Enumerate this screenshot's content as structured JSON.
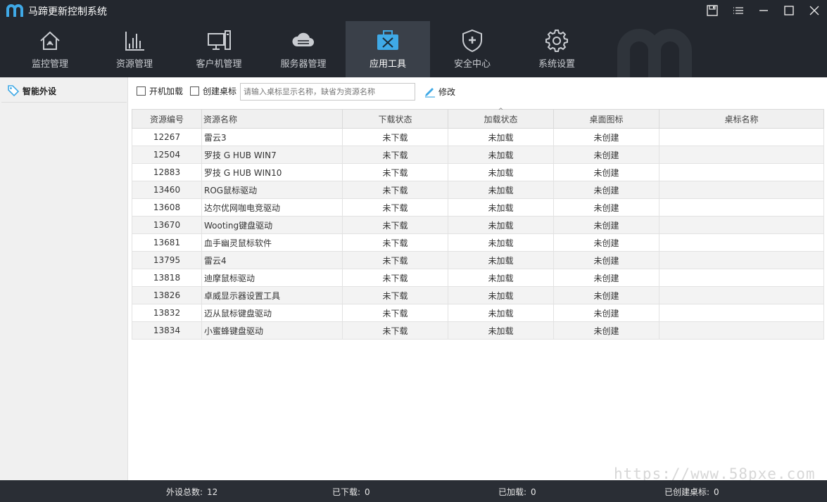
{
  "app": {
    "title": "马蹄更新控制系统"
  },
  "nav": [
    {
      "label": "监控管理",
      "icon": "home-monitor-icon"
    },
    {
      "label": "资源管理",
      "icon": "bar-chart-icon"
    },
    {
      "label": "客户机管理",
      "icon": "monitor-pc-icon"
    },
    {
      "label": "服务器管理",
      "icon": "cloud-server-icon"
    },
    {
      "label": "应用工具",
      "icon": "toolbox-icon",
      "active": true
    },
    {
      "label": "安全中心",
      "icon": "shield-icon"
    },
    {
      "label": "系统设置",
      "icon": "gear-icon"
    }
  ],
  "sidebar": {
    "items": [
      {
        "label": "智能外设",
        "icon": "tag-icon"
      }
    ]
  },
  "toolbar": {
    "autoload_label": "开机加载",
    "create_shortcut_label": "创建桌标",
    "name_placeholder": "请输入桌标显示名称，缺省为资源名称",
    "edit_label": "修改"
  },
  "table": {
    "columns": [
      "资源编号",
      "资源名称",
      "下载状态",
      "加载状态",
      "桌面图标",
      "桌标名称"
    ],
    "rows": [
      [
        "12267",
        "雷云3",
        "未下载",
        "未加载",
        "未创建",
        ""
      ],
      [
        "12504",
        "罗技 G HUB WIN7",
        "未下载",
        "未加载",
        "未创建",
        ""
      ],
      [
        "12883",
        "罗技 G HUB WIN10",
        "未下载",
        "未加载",
        "未创建",
        ""
      ],
      [
        "13460",
        "ROG鼠标驱动",
        "未下载",
        "未加载",
        "未创建",
        ""
      ],
      [
        "13608",
        "达尔优网咖电竞驱动",
        "未下载",
        "未加载",
        "未创建",
        ""
      ],
      [
        "13670",
        "Wooting键盘驱动",
        "未下载",
        "未加载",
        "未创建",
        ""
      ],
      [
        "13681",
        "血手幽灵鼠标软件",
        "未下载",
        "未加载",
        "未创建",
        ""
      ],
      [
        "13795",
        "雷云4",
        "未下载",
        "未加载",
        "未创建",
        ""
      ],
      [
        "13818",
        "迪摩鼠标驱动",
        "未下载",
        "未加载",
        "未创建",
        ""
      ],
      [
        "13826",
        "卓威显示器设置工具",
        "未下载",
        "未加载",
        "未创建",
        ""
      ],
      [
        "13832",
        "迈从鼠标键盘驱动",
        "未下载",
        "未加载",
        "未创建",
        ""
      ],
      [
        "13834",
        "小蜜蜂键盘驱动",
        "未下载",
        "未加载",
        "未创建",
        ""
      ]
    ]
  },
  "status": {
    "total_label": "外设总数:",
    "total_value": "12",
    "downloaded_label": "已下载:",
    "downloaded_value": "0",
    "loaded_label": "已加载:",
    "loaded_value": "0",
    "created_label": "已创建桌标:",
    "created_value": "0"
  },
  "watermark": "https://www.58pxe.com",
  "colors": {
    "header_bg": "#23272e",
    "active_tab": "#3a4049",
    "accent_blue": "#3fa9e6"
  }
}
